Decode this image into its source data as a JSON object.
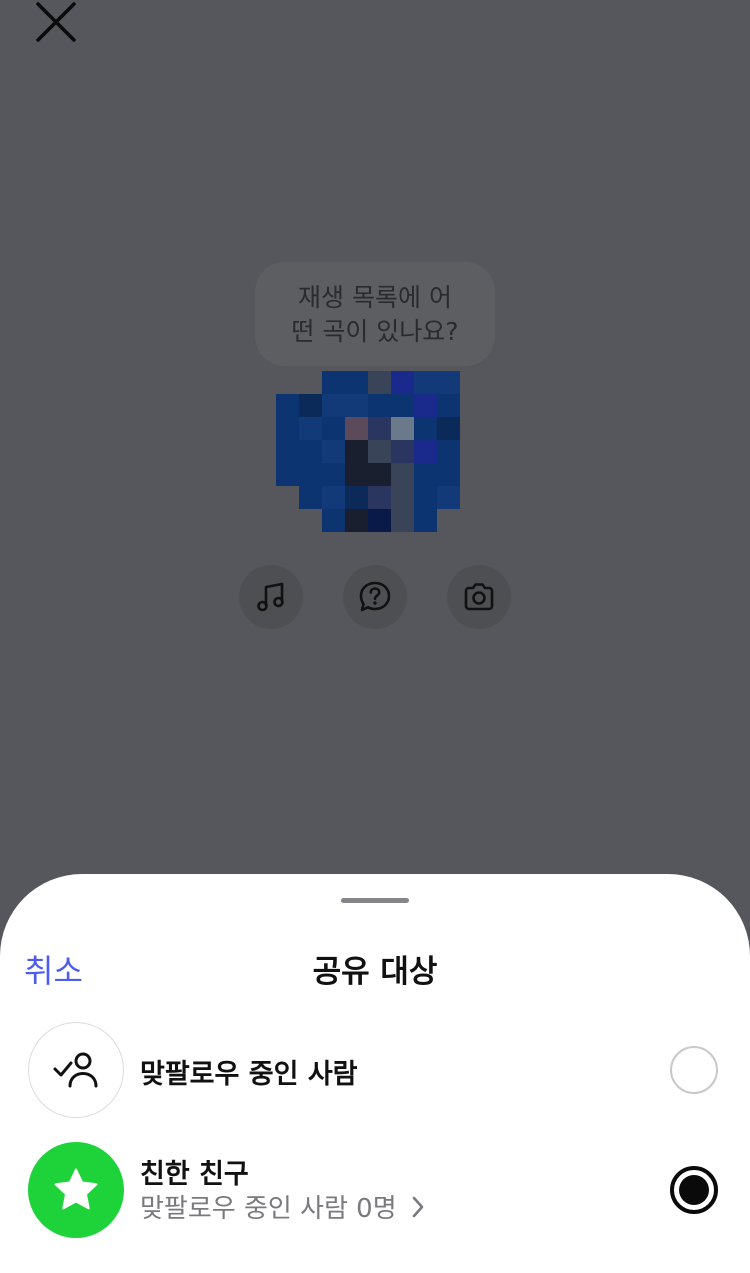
{
  "background": {
    "note_lines": [
      "재생 목록에 어",
      "떤 곡이 있나요?"
    ]
  },
  "tools": [
    {
      "name": "music-note-icon"
    },
    {
      "name": "question-bubble-icon"
    },
    {
      "name": "camera-icon"
    }
  ],
  "sheet": {
    "cancel_label": "취소",
    "title": "공유 대상",
    "options": [
      {
        "label": "맞팔로우 중인 사람",
        "icon": "person-check-icon",
        "selected": false
      },
      {
        "label": "친한 친구",
        "sublabel": "맞팔로우 중인 사람 0명",
        "icon": "star-icon",
        "selected": true
      }
    ]
  },
  "colors": {
    "accent": "#4c5ded",
    "close_friends_green": "#1ed33a",
    "dim_overlay": "#56575c"
  }
}
